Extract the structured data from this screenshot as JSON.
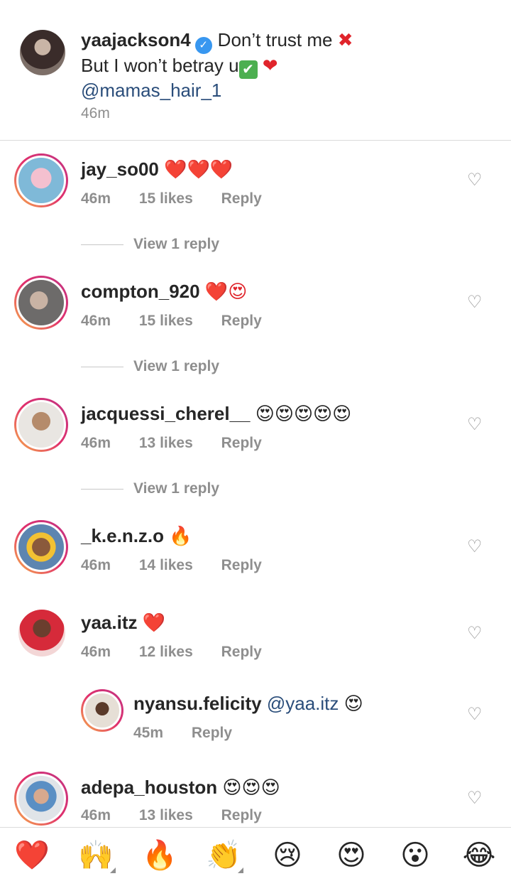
{
  "caption": {
    "username": "yaajackson4",
    "text_line1": "Don’t trust me",
    "text_line2": "But I won’t betray u",
    "mention": "@mamas_hair_1",
    "time": "46m"
  },
  "comments": [
    {
      "username": "jay_so00",
      "emojis": "❤️❤️❤️",
      "time": "46m",
      "likes": "15 likes",
      "reply": "Reply",
      "view_reply": "View 1 reply"
    },
    {
      "username": "compton_920",
      "emojis": "❤️😍",
      "time": "46m",
      "likes": "15 likes",
      "reply": "Reply",
      "view_reply": "View 1 reply"
    },
    {
      "username": "jacquessi_cherel__",
      "emojis": "😍😍😍😍😍",
      "time": "46m",
      "likes": "13 likes",
      "reply": "Reply",
      "view_reply": "View 1 reply"
    },
    {
      "username": "_k.e.n.z.o",
      "emojis": "🔥",
      "time": "46m",
      "likes": "14 likes",
      "reply": "Reply"
    },
    {
      "username": "yaa.itz",
      "emojis": "❤️",
      "time": "46m",
      "likes": "12 likes",
      "reply": "Reply"
    },
    {
      "username": "adepa_houston",
      "emojis": "😍😍😍",
      "time": "46m",
      "likes": "13 likes",
      "reply": "Reply"
    }
  ],
  "reply": {
    "username": "nyansu.felicity",
    "mention": "@yaa.itz",
    "emojis": "😍",
    "time": "45m",
    "reply": "Reply"
  },
  "emoji_bar": [
    "❤️",
    "🙌",
    "🔥",
    "👏",
    "😢",
    "😍",
    "😮",
    "😂"
  ],
  "icons": {
    "like": "heart-outline-icon",
    "verified": "verified-badge-icon"
  },
  "colors": {
    "accent": "#3897f0",
    "mention": "#2a4d7a",
    "muted": "#8e8e8e"
  }
}
